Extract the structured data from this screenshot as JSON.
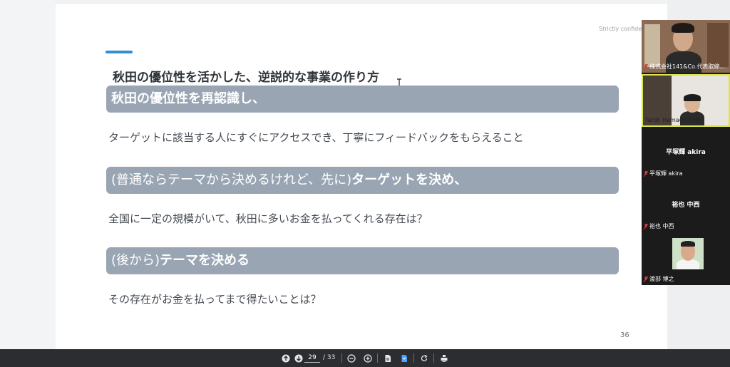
{
  "slide": {
    "confidential": "Strictly confide",
    "title": "秋田の優位性を活かした、逆説的な事業の作り方",
    "band1": "秋田の優位性を再認識し、",
    "line1": "ターゲットに該当する人にすぐにアクセスでき、丁寧にフィードバックをもらえること",
    "band2_lead": "(普通ならテーマから決めるけれど、先に)",
    "band2_strong": "ターゲットを決め、",
    "line2": "全国に一定の規模がいて、秋田に多いお金を払ってくれる存在は？",
    "band3_lead": "(後から)",
    "band3_strong": "テーマを決める",
    "line3": "その存在がお金を払ってまで得たいことは？",
    "page_number": "36"
  },
  "participants": [
    {
      "name": "株式会社141&Co.代表取締...",
      "video": true
    },
    {
      "name": "Taroh Hamada_ENV",
      "video": true,
      "active_speaker": true
    },
    {
      "display_name": "平塚輝 akira",
      "name": "平塚輝 akira",
      "video": false
    },
    {
      "display_name": "裕也 中西",
      "name": "裕也 中西",
      "video": false
    },
    {
      "name": "渡部 博之",
      "video": false,
      "avatar": true
    }
  ],
  "toolbar": {
    "current_page": "29",
    "total_pages": "/ 33",
    "icons": [
      "page-up-icon",
      "page-down-icon",
      "zoom-out-icon",
      "zoom-in-icon",
      "document-icon",
      "bookmark-icon",
      "rotate-icon",
      "print-icon"
    ]
  },
  "colors": {
    "accent": "#2f8fd6",
    "band": "#9aa5b4",
    "toolbar": "#2b2d30",
    "active_speaker_border": "#d9e34b"
  }
}
